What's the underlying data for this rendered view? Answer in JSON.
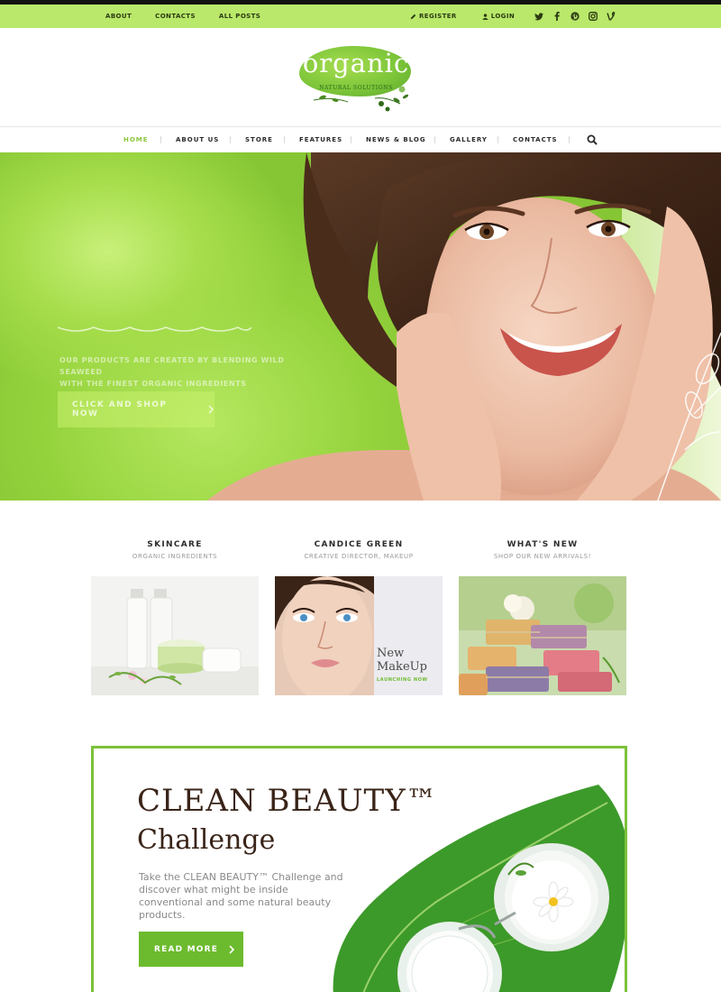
{
  "topbar": {
    "links": [
      "ABOUT",
      "CONTACTS",
      "ALL POSTS"
    ],
    "register": "REGISTER",
    "login": "LOGIN",
    "social": [
      "twitter-icon",
      "facebook-icon",
      "pinterest-icon",
      "instagram-icon",
      "vine-icon"
    ]
  },
  "logo": {
    "word": "organic",
    "tagline": "NATURAL SOLUTIONS"
  },
  "nav": {
    "items": [
      "HOME",
      "ABOUT US",
      "STORE",
      "FEATURES",
      "NEWS & BLOG",
      "GALLERY",
      "CONTACTS"
    ],
    "active": "HOME"
  },
  "hero": {
    "subtitle_line1": "OUR PRODUCTS ARE CREATED BY BLENDING WILD SEAWEED",
    "subtitle_line2": "WITH THE FINEST ORGANIC INGREDIENTS",
    "cta": "CLICK AND SHOP NOW"
  },
  "features": [
    {
      "title": "SKINCARE",
      "subtitle": "ORGANIC INGREDIENTS"
    },
    {
      "title": "CANDICE GREEN",
      "subtitle": "CREATIVE DIRECTOR, MAKEUP",
      "overlay_title": "New",
      "overlay_title2": "MakeUp",
      "overlay_sub": "LAUNCHING NOW"
    },
    {
      "title": "WHAT'S NEW",
      "subtitle": "SHOP OUR NEW ARRIVALS!"
    }
  ],
  "challenge": {
    "title1": "CLEAN BEAUTY™",
    "title2": "Challenge",
    "description": "Take the CLEAN BEAUTY™ Challenge and discover what might be inside conventional and some natural beauty products.",
    "button": "READ MORE"
  },
  "colors": {
    "accent": "#8cc63f",
    "topbar": "#b9e86a",
    "button": "#6cbb2e",
    "title": "#3a2418"
  }
}
